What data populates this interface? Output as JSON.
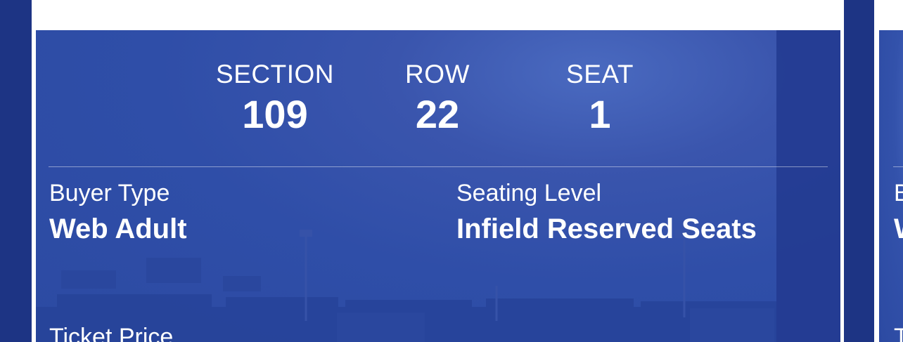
{
  "ticket": {
    "section_label": "SECTION",
    "section_value": "109",
    "row_label": "ROW",
    "row_value": "22",
    "seat_label": "SEAT",
    "seat_value": "1",
    "buyer_type_label": "Buyer Type",
    "buyer_type_value": "Web Adult",
    "seating_level_label": "Seating Level",
    "seating_level_value": "Infield Reserved Seats",
    "ticket_price_label": "Ticket Price"
  },
  "next_ticket": {
    "buyer_type_label_peek": "B",
    "buyer_type_value_peek": "W",
    "ticket_price_label_peek": "T"
  },
  "colors": {
    "background": "#1d3484",
    "card_blue": "#2f4ea8",
    "text": "#ffffff"
  }
}
